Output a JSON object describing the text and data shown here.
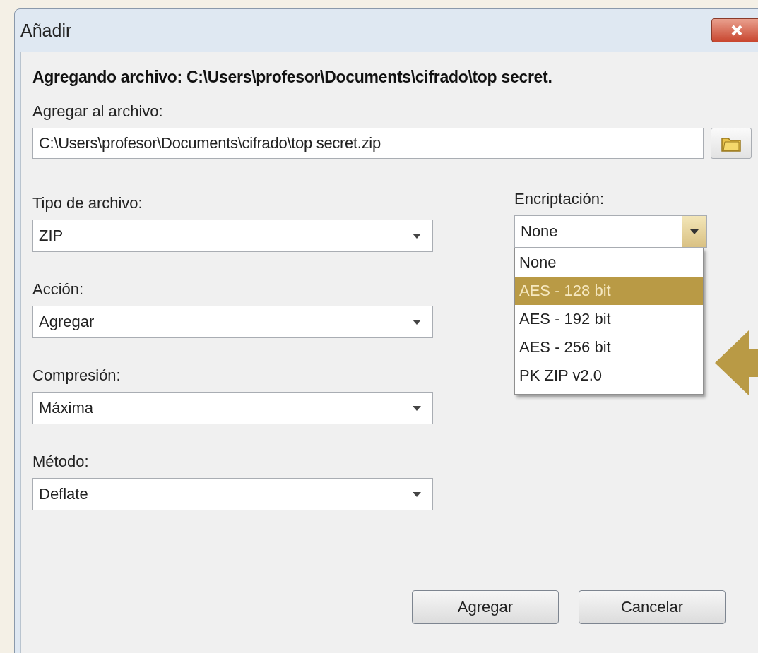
{
  "window": {
    "title": "Añadir"
  },
  "heading": "Agregando archivo: C:\\Users\\profesor\\Documents\\cifrado\\top secret.",
  "archive": {
    "label": "Agregar al archivo:",
    "value": "C:\\Users\\profesor\\Documents\\cifrado\\top secret.zip"
  },
  "fields": [
    {
      "label": "Tipo de archivo:",
      "value": "ZIP"
    },
    {
      "label": "Acción:",
      "value": "Agregar"
    },
    {
      "label": "Compresión:",
      "value": "Máxima"
    },
    {
      "label": "Método:",
      "value": "Deflate"
    }
  ],
  "encryption": {
    "label": "Encriptación:",
    "value": "None",
    "expanded": true,
    "options": [
      {
        "label": "None",
        "highlighted": false
      },
      {
        "label": "AES - 128 bit",
        "highlighted": true
      },
      {
        "label": "AES - 192 bit",
        "highlighted": false
      },
      {
        "label": "AES - 256 bit",
        "highlighted": false
      },
      {
        "label": "PK ZIP v2.0",
        "highlighted": false
      }
    ]
  },
  "buttons": [
    "Agregar",
    "Cancelar"
  ]
}
